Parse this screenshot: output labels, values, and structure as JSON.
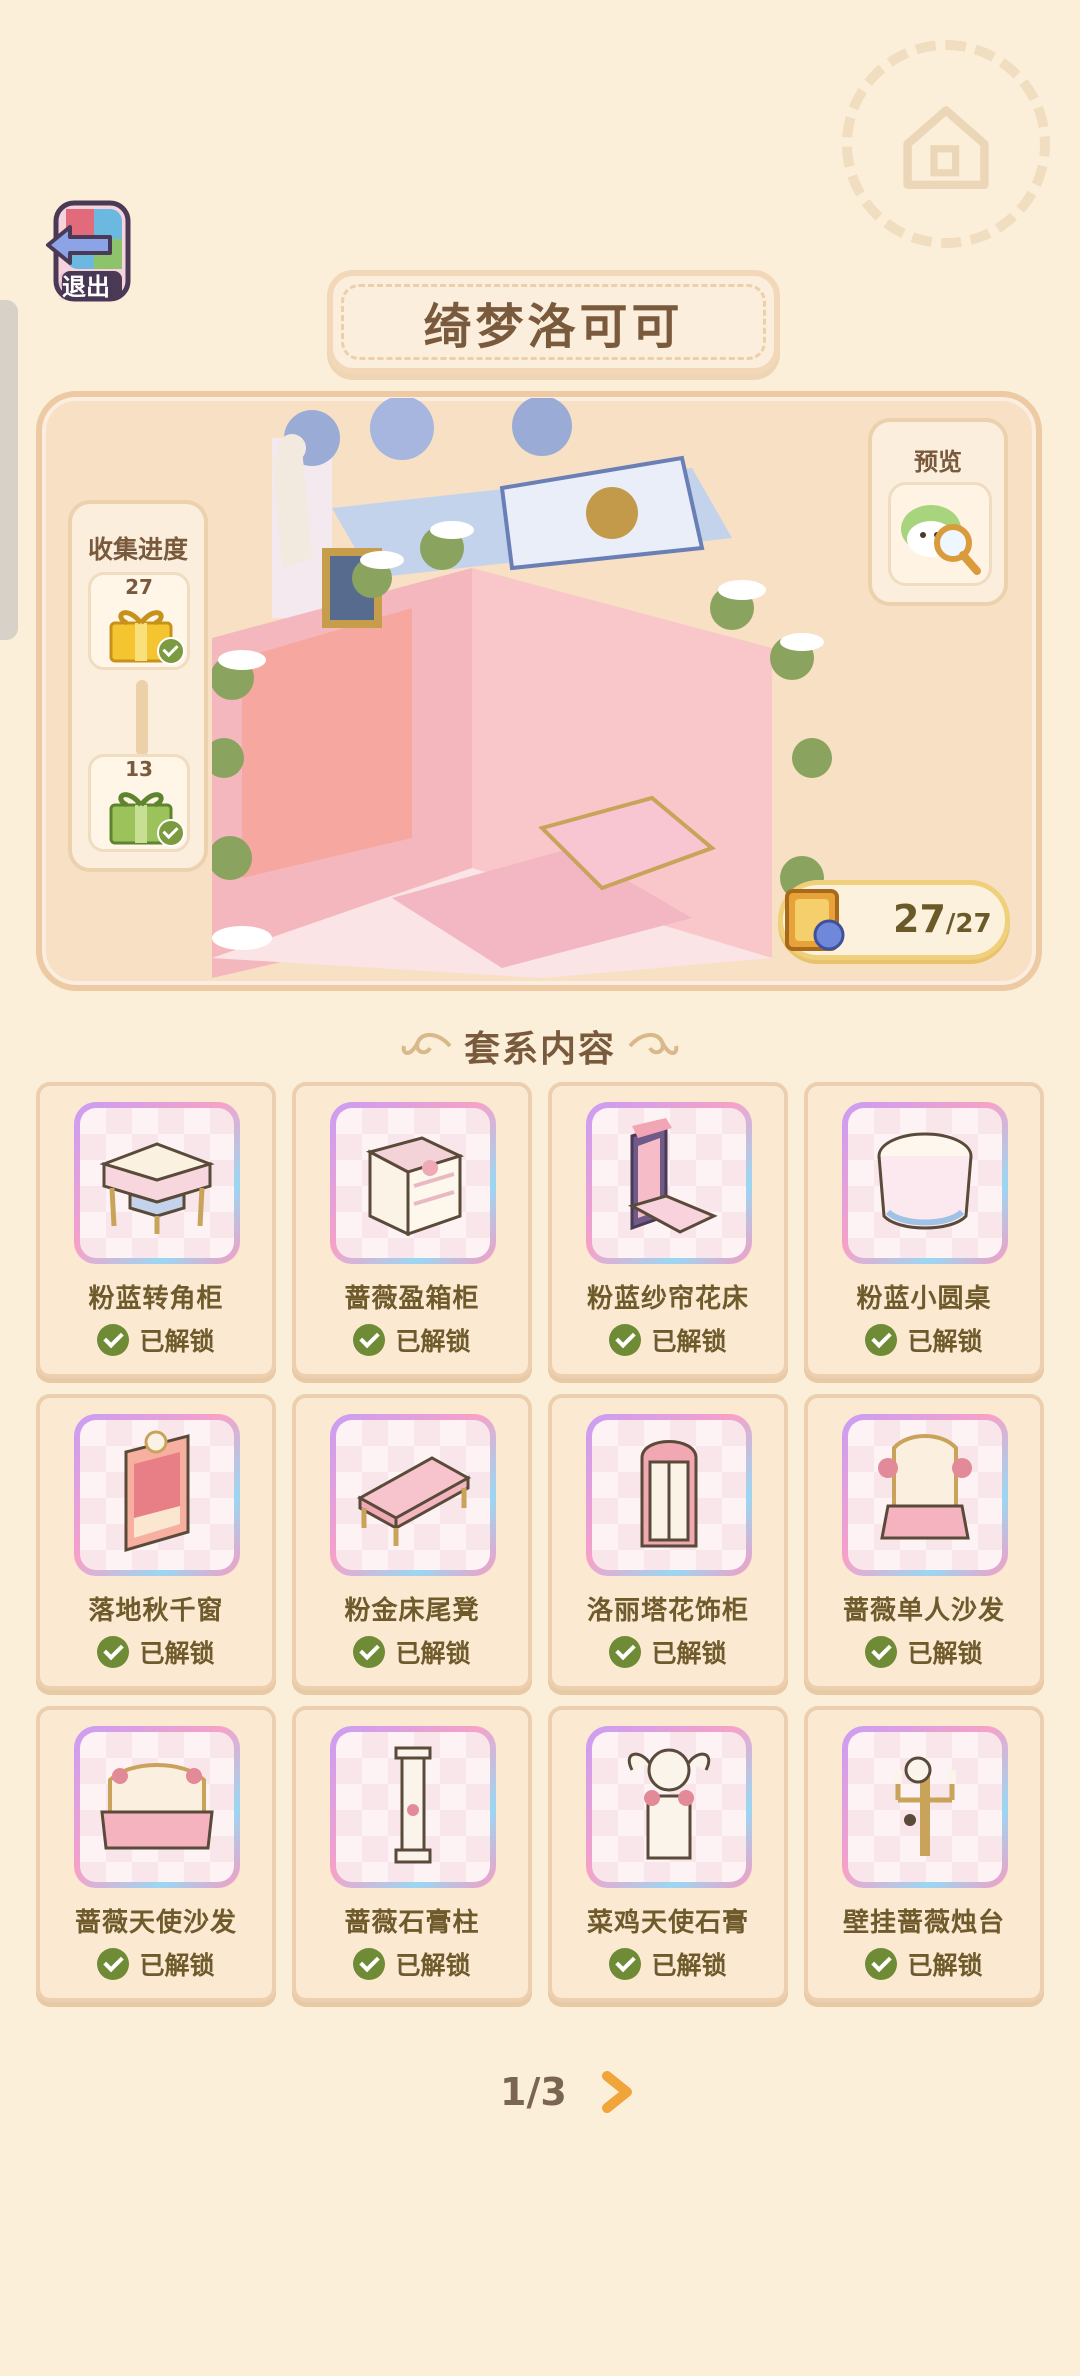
{
  "header": {
    "exit_label": "退出",
    "title": "绮梦洛可可"
  },
  "collection": {
    "title": "收集进度",
    "milestones": [
      {
        "count": "27",
        "icon": "yellow-gift-icon",
        "claimed": true
      },
      {
        "count": "13",
        "icon": "green-gift-icon",
        "claimed": true
      }
    ]
  },
  "preview": {
    "label": "预览",
    "icon": "magnifier-character-icon"
  },
  "progress": {
    "current": "27",
    "total": "/27"
  },
  "section": {
    "title": "套系内容"
  },
  "items": [
    {
      "name": "粉蓝转角柜",
      "status": "已解锁",
      "icon": "corner-cabinet-icon"
    },
    {
      "name": "蔷薇盈箱柜",
      "status": "已解锁",
      "icon": "drawer-cabinet-icon"
    },
    {
      "name": "粉蓝纱帘花床",
      "status": "已解锁",
      "icon": "canopy-bed-icon"
    },
    {
      "name": "粉蓝小圆桌",
      "status": "已解锁",
      "icon": "round-table-icon"
    },
    {
      "name": "落地秋千窗",
      "status": "已解锁",
      "icon": "window-icon"
    },
    {
      "name": "粉金床尾凳",
      "status": "已解锁",
      "icon": "bench-icon"
    },
    {
      "name": "洛丽塔花饰柜",
      "status": "已解锁",
      "icon": "wardrobe-icon"
    },
    {
      "name": "蔷薇单人沙发",
      "status": "已解锁",
      "icon": "armchair-icon"
    },
    {
      "name": "蔷薇天使沙发",
      "status": "已解锁",
      "icon": "sofa-icon"
    },
    {
      "name": "蔷薇石膏柱",
      "status": "已解锁",
      "icon": "pillar-icon"
    },
    {
      "name": "菜鸡天使石膏",
      "status": "已解锁",
      "icon": "angel-statue-icon"
    },
    {
      "name": "壁挂蔷薇烛台",
      "status": "已解锁",
      "icon": "candle-sconce-icon"
    }
  ],
  "pagination": {
    "label": "1/3"
  },
  "colors": {
    "background": "#fcefd9",
    "accent_green": "#6f8b35",
    "text_brown": "#7a5a3d",
    "arrow_orange": "#f0a43a"
  }
}
